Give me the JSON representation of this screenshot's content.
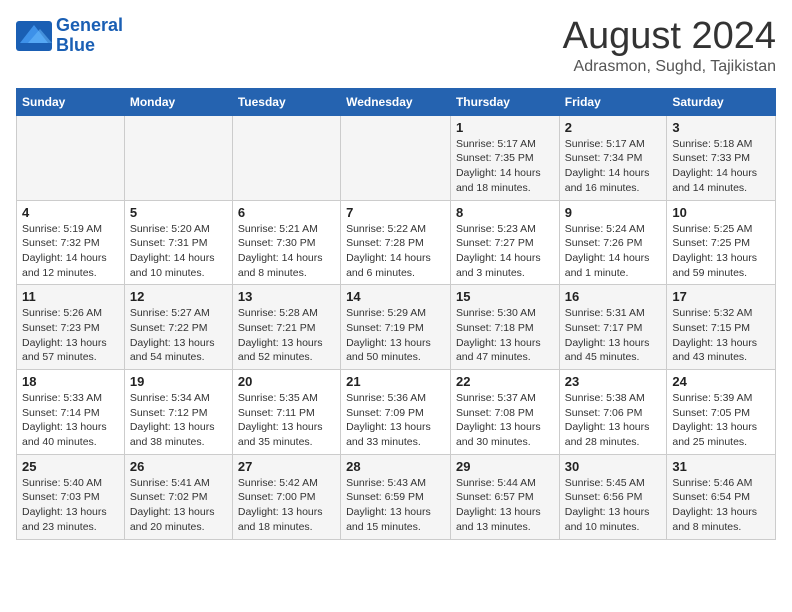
{
  "logo": {
    "line1": "General",
    "line2": "Blue"
  },
  "title": "August 2024",
  "location": "Adrasmon, Sughd, Tajikistan",
  "days_of_week": [
    "Sunday",
    "Monday",
    "Tuesday",
    "Wednesday",
    "Thursday",
    "Friday",
    "Saturday"
  ],
  "weeks": [
    [
      {
        "num": "",
        "info": ""
      },
      {
        "num": "",
        "info": ""
      },
      {
        "num": "",
        "info": ""
      },
      {
        "num": "",
        "info": ""
      },
      {
        "num": "1",
        "info": "Sunrise: 5:17 AM\nSunset: 7:35 PM\nDaylight: 14 hours\nand 18 minutes."
      },
      {
        "num": "2",
        "info": "Sunrise: 5:17 AM\nSunset: 7:34 PM\nDaylight: 14 hours\nand 16 minutes."
      },
      {
        "num": "3",
        "info": "Sunrise: 5:18 AM\nSunset: 7:33 PM\nDaylight: 14 hours\nand 14 minutes."
      }
    ],
    [
      {
        "num": "4",
        "info": "Sunrise: 5:19 AM\nSunset: 7:32 PM\nDaylight: 14 hours\nand 12 minutes."
      },
      {
        "num": "5",
        "info": "Sunrise: 5:20 AM\nSunset: 7:31 PM\nDaylight: 14 hours\nand 10 minutes."
      },
      {
        "num": "6",
        "info": "Sunrise: 5:21 AM\nSunset: 7:30 PM\nDaylight: 14 hours\nand 8 minutes."
      },
      {
        "num": "7",
        "info": "Sunrise: 5:22 AM\nSunset: 7:28 PM\nDaylight: 14 hours\nand 6 minutes."
      },
      {
        "num": "8",
        "info": "Sunrise: 5:23 AM\nSunset: 7:27 PM\nDaylight: 14 hours\nand 3 minutes."
      },
      {
        "num": "9",
        "info": "Sunrise: 5:24 AM\nSunset: 7:26 PM\nDaylight: 14 hours\nand 1 minute."
      },
      {
        "num": "10",
        "info": "Sunrise: 5:25 AM\nSunset: 7:25 PM\nDaylight: 13 hours\nand 59 minutes."
      }
    ],
    [
      {
        "num": "11",
        "info": "Sunrise: 5:26 AM\nSunset: 7:23 PM\nDaylight: 13 hours\nand 57 minutes."
      },
      {
        "num": "12",
        "info": "Sunrise: 5:27 AM\nSunset: 7:22 PM\nDaylight: 13 hours\nand 54 minutes."
      },
      {
        "num": "13",
        "info": "Sunrise: 5:28 AM\nSunset: 7:21 PM\nDaylight: 13 hours\nand 52 minutes."
      },
      {
        "num": "14",
        "info": "Sunrise: 5:29 AM\nSunset: 7:19 PM\nDaylight: 13 hours\nand 50 minutes."
      },
      {
        "num": "15",
        "info": "Sunrise: 5:30 AM\nSunset: 7:18 PM\nDaylight: 13 hours\nand 47 minutes."
      },
      {
        "num": "16",
        "info": "Sunrise: 5:31 AM\nSunset: 7:17 PM\nDaylight: 13 hours\nand 45 minutes."
      },
      {
        "num": "17",
        "info": "Sunrise: 5:32 AM\nSunset: 7:15 PM\nDaylight: 13 hours\nand 43 minutes."
      }
    ],
    [
      {
        "num": "18",
        "info": "Sunrise: 5:33 AM\nSunset: 7:14 PM\nDaylight: 13 hours\nand 40 minutes."
      },
      {
        "num": "19",
        "info": "Sunrise: 5:34 AM\nSunset: 7:12 PM\nDaylight: 13 hours\nand 38 minutes."
      },
      {
        "num": "20",
        "info": "Sunrise: 5:35 AM\nSunset: 7:11 PM\nDaylight: 13 hours\nand 35 minutes."
      },
      {
        "num": "21",
        "info": "Sunrise: 5:36 AM\nSunset: 7:09 PM\nDaylight: 13 hours\nand 33 minutes."
      },
      {
        "num": "22",
        "info": "Sunrise: 5:37 AM\nSunset: 7:08 PM\nDaylight: 13 hours\nand 30 minutes."
      },
      {
        "num": "23",
        "info": "Sunrise: 5:38 AM\nSunset: 7:06 PM\nDaylight: 13 hours\nand 28 minutes."
      },
      {
        "num": "24",
        "info": "Sunrise: 5:39 AM\nSunset: 7:05 PM\nDaylight: 13 hours\nand 25 minutes."
      }
    ],
    [
      {
        "num": "25",
        "info": "Sunrise: 5:40 AM\nSunset: 7:03 PM\nDaylight: 13 hours\nand 23 minutes."
      },
      {
        "num": "26",
        "info": "Sunrise: 5:41 AM\nSunset: 7:02 PM\nDaylight: 13 hours\nand 20 minutes."
      },
      {
        "num": "27",
        "info": "Sunrise: 5:42 AM\nSunset: 7:00 PM\nDaylight: 13 hours\nand 18 minutes."
      },
      {
        "num": "28",
        "info": "Sunrise: 5:43 AM\nSunset: 6:59 PM\nDaylight: 13 hours\nand 15 minutes."
      },
      {
        "num": "29",
        "info": "Sunrise: 5:44 AM\nSunset: 6:57 PM\nDaylight: 13 hours\nand 13 minutes."
      },
      {
        "num": "30",
        "info": "Sunrise: 5:45 AM\nSunset: 6:56 PM\nDaylight: 13 hours\nand 10 minutes."
      },
      {
        "num": "31",
        "info": "Sunrise: 5:46 AM\nSunset: 6:54 PM\nDaylight: 13 hours\nand 8 minutes."
      }
    ]
  ]
}
